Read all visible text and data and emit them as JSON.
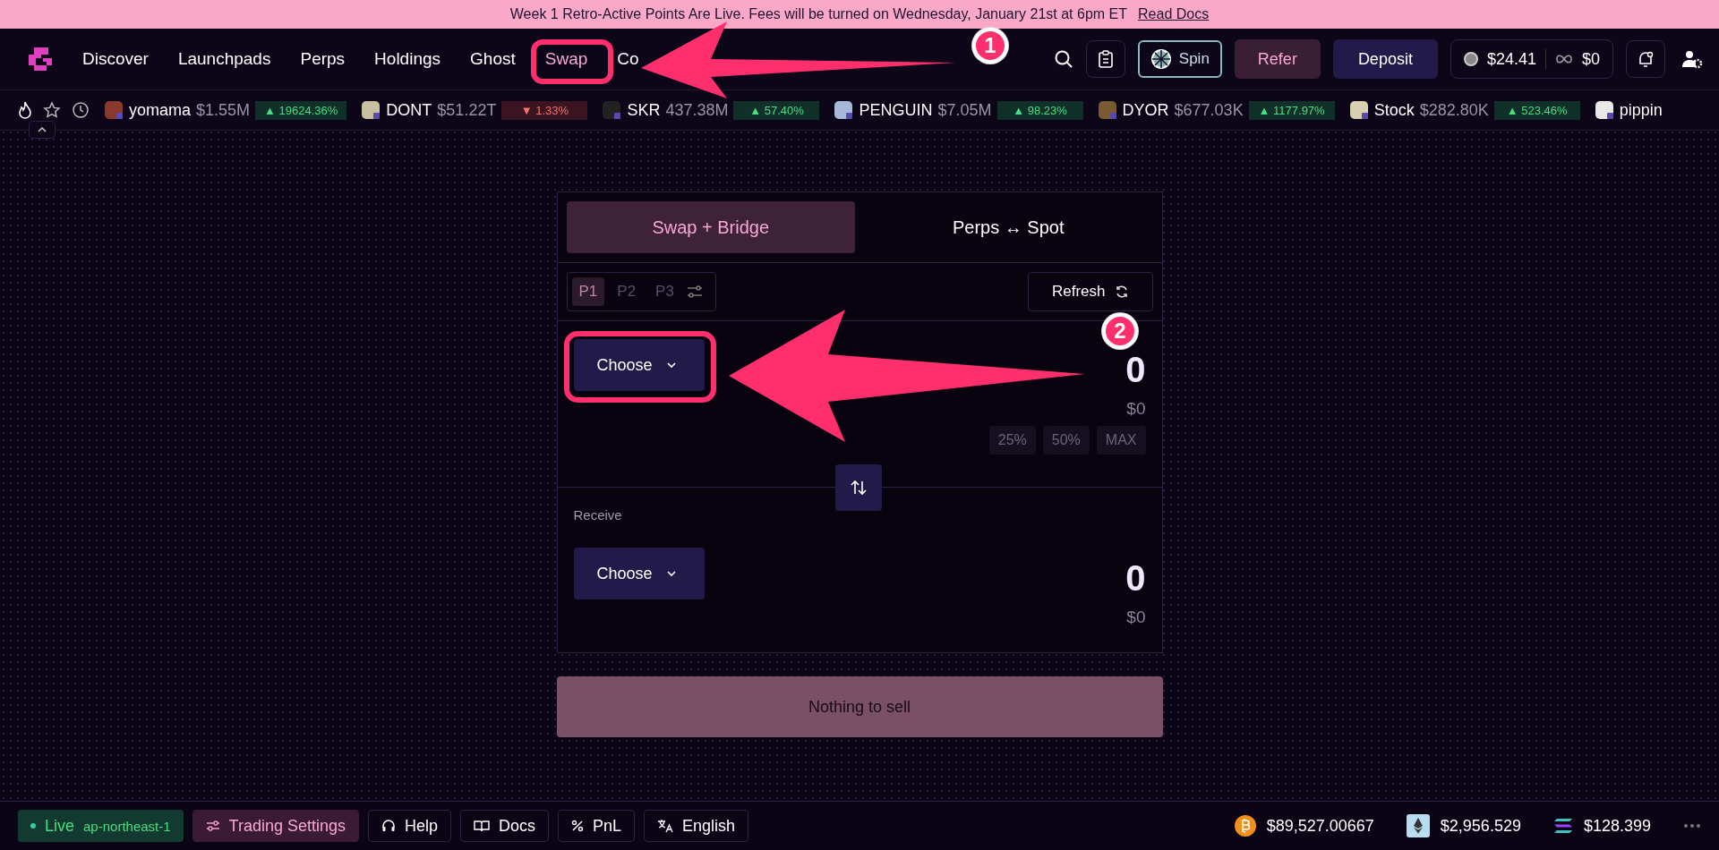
{
  "banner": {
    "text": "Week 1 Retro-Active Points Are Live. Fees will be turned on Wednesday, January 21st at 6pm ET",
    "link": "Read Docs"
  },
  "nav": {
    "items": [
      {
        "label": "Discover",
        "selected": false
      },
      {
        "label": "Launchpads",
        "selected": false
      },
      {
        "label": "Perps",
        "selected": false
      },
      {
        "label": "Holdings",
        "selected": false
      },
      {
        "label": "Ghost",
        "selected": false
      },
      {
        "label": "Swap",
        "selected": true
      },
      {
        "label": "Co",
        "selected": false
      }
    ],
    "spin": "Spin",
    "refer": "Refer",
    "deposit": "Deposit",
    "balance": "$24.41",
    "credit": "$0"
  },
  "ticker": [
    {
      "name": "yomama",
      "price": "$1.55M",
      "change": "▲ 19624.36%",
      "kind": "up"
    },
    {
      "name": "DONT",
      "price": "$51.22T",
      "change": "▼ 1.33%",
      "kind": "down"
    },
    {
      "name": "SKR",
      "price": "437.38M",
      "change": "▲ 57.40%",
      "kind": "up"
    },
    {
      "name": "PENGUIN",
      "price": "$7.05M",
      "change": "▲ 98.23%",
      "kind": "up"
    },
    {
      "name": "DYOR",
      "price": "$677.03K",
      "change": "▲ 1177.97%",
      "kind": "up"
    },
    {
      "name": "Stock",
      "price": "$282.80K",
      "change": "▲ 523.46%",
      "kind": "up"
    },
    {
      "name": "pippin"
    }
  ],
  "swap": {
    "tabs": [
      {
        "label": "Swap + Bridge",
        "selected": true
      },
      {
        "label": "Perps ↔ Spot",
        "selected": false
      }
    ],
    "presets": [
      {
        "label": "P1",
        "selected": true
      },
      {
        "label": "P2",
        "selected": false
      },
      {
        "label": "P3",
        "selected": false
      }
    ],
    "refresh": "Refresh",
    "sell": {
      "choose": "Choose",
      "amount": "0",
      "usd": "$0",
      "percents": [
        "25%",
        "50%",
        "MAX"
      ]
    },
    "receive": {
      "label": "Receive",
      "choose": "Choose",
      "amount": "0",
      "usd": "$0"
    },
    "action": "Nothing to sell"
  },
  "status": {
    "live": "Live",
    "region": "ap-northeast-1",
    "buttons": [
      {
        "label": "Trading Settings",
        "kind": "settings"
      },
      {
        "label": "Help",
        "kind": "help"
      },
      {
        "label": "Docs",
        "kind": "docs"
      },
      {
        "label": "PnL",
        "kind": "pnl"
      },
      {
        "label": "English",
        "kind": "language"
      }
    ],
    "prices": [
      {
        "kind": "btc",
        "price": "$89,527.00667"
      },
      {
        "kind": "eth",
        "price": "$2,956.529"
      },
      {
        "kind": "sol",
        "price": "$128.399"
      }
    ]
  },
  "annotations": [
    {
      "number": "1"
    },
    {
      "number": "2"
    }
  ]
}
